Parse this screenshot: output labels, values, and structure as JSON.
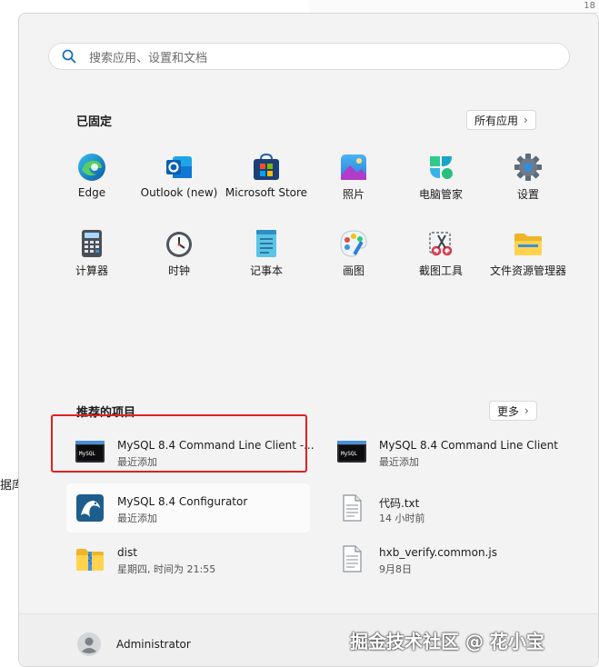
{
  "corner_number": "18",
  "background_text": "据库",
  "search": {
    "placeholder": "搜索应用、设置和文档"
  },
  "pinned": {
    "title": "已固定",
    "all_apps_label": "所有应用",
    "apps": [
      {
        "label": "Edge",
        "icon": "edge-icon"
      },
      {
        "label": "Outlook (new)",
        "icon": "outlook-icon"
      },
      {
        "label": "Microsoft Store",
        "icon": "store-icon"
      },
      {
        "label": "照片",
        "icon": "photos-icon"
      },
      {
        "label": "电脑管家",
        "icon": "pc-manager-icon"
      },
      {
        "label": "设置",
        "icon": "settings-icon"
      },
      {
        "label": "计算器",
        "icon": "calculator-icon"
      },
      {
        "label": "时钟",
        "icon": "clock-icon"
      },
      {
        "label": "记事本",
        "icon": "notepad-icon"
      },
      {
        "label": "画图",
        "icon": "paint-icon"
      },
      {
        "label": "截图工具",
        "icon": "snipping-tool-icon"
      },
      {
        "label": "文件资源管理器",
        "icon": "file-explorer-icon"
      }
    ]
  },
  "recommended": {
    "title": "推荐的项目",
    "more_label": "更多",
    "items": [
      {
        "title": "MySQL 8.4 Command Line Client -...",
        "subtitle": "最近添加",
        "icon": "mysql-cli-icon"
      },
      {
        "title": "MySQL 8.4 Command Line Client",
        "subtitle": "最近添加",
        "icon": "mysql-cli-icon"
      },
      {
        "title": "MySQL 8.4 Configurator",
        "subtitle": "最近添加",
        "icon": "mysql-configurator-icon"
      },
      {
        "title": "代码.txt",
        "subtitle": "14 小时前",
        "icon": "document-icon"
      },
      {
        "title": "dist",
        "subtitle": "星期四, 时间为 21:55",
        "icon": "zip-folder-icon"
      },
      {
        "title": "hxb_verify.common.js",
        "subtitle": "9月8日",
        "icon": "document-icon"
      }
    ]
  },
  "footer": {
    "user_name": "Administrator"
  },
  "watermark": "掘金技术社区 @ 花小宝",
  "colors": {
    "highlight_border": "#e02020",
    "panel_bg": "#f3f3f3"
  }
}
